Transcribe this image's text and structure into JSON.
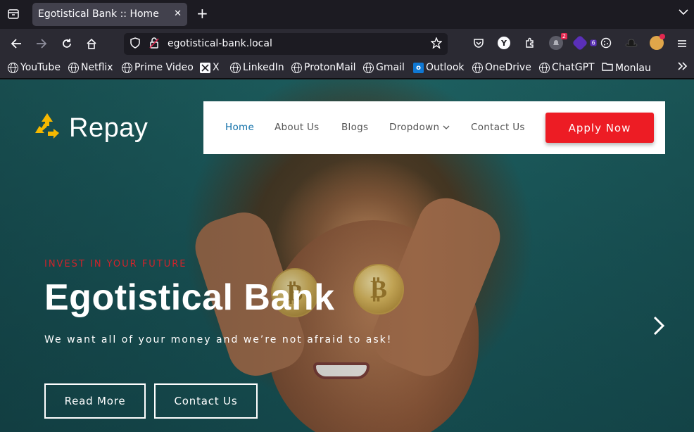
{
  "browser": {
    "tab_title": "Egotistical Bank :: Home",
    "close_glyph": "✕",
    "new_tab_glyph": "+",
    "url": "egotistical-bank.local",
    "extension_badges": {
      "notifications": "2",
      "purple_ext": "6"
    }
  },
  "bookmarks": [
    {
      "label": "YouTube",
      "icon": "globe-icon"
    },
    {
      "label": "Netflix",
      "icon": "globe-icon"
    },
    {
      "label": "Prime Video",
      "icon": "globe-icon"
    },
    {
      "label": "X",
      "icon": "x-logo-icon"
    },
    {
      "label": "LinkedIn",
      "icon": "globe-icon"
    },
    {
      "label": "ProtonMail",
      "icon": "globe-icon"
    },
    {
      "label": "Gmail",
      "icon": "globe-icon"
    },
    {
      "label": "Outlook",
      "icon": "outlook-icon"
    },
    {
      "label": "OneDrive",
      "icon": "globe-icon"
    },
    {
      "label": "ChatGPT",
      "icon": "globe-icon"
    },
    {
      "label": "Monlau",
      "icon": "folder-icon"
    }
  ],
  "site": {
    "brand": "Repay",
    "nav": [
      "Home",
      "About Us",
      "Blogs",
      "Dropdown",
      "Contact Us"
    ],
    "dropdown_caret": "⌄",
    "apply_label": "Apply Now",
    "hero": {
      "kicker": "INVEST IN YOUR FUTURE",
      "title": "Egotistical Bank",
      "subtitle": "We want all of your money and we’re not afraid to ask!",
      "read_more": "Read More",
      "contact": "Contact Us"
    },
    "next_glyph": "›"
  },
  "colors": {
    "accent_red": "#ed1c24",
    "nav_active": "#0f6fa8",
    "logo_yellow": "#f5b800",
    "hero_teal": "#1f6666"
  }
}
